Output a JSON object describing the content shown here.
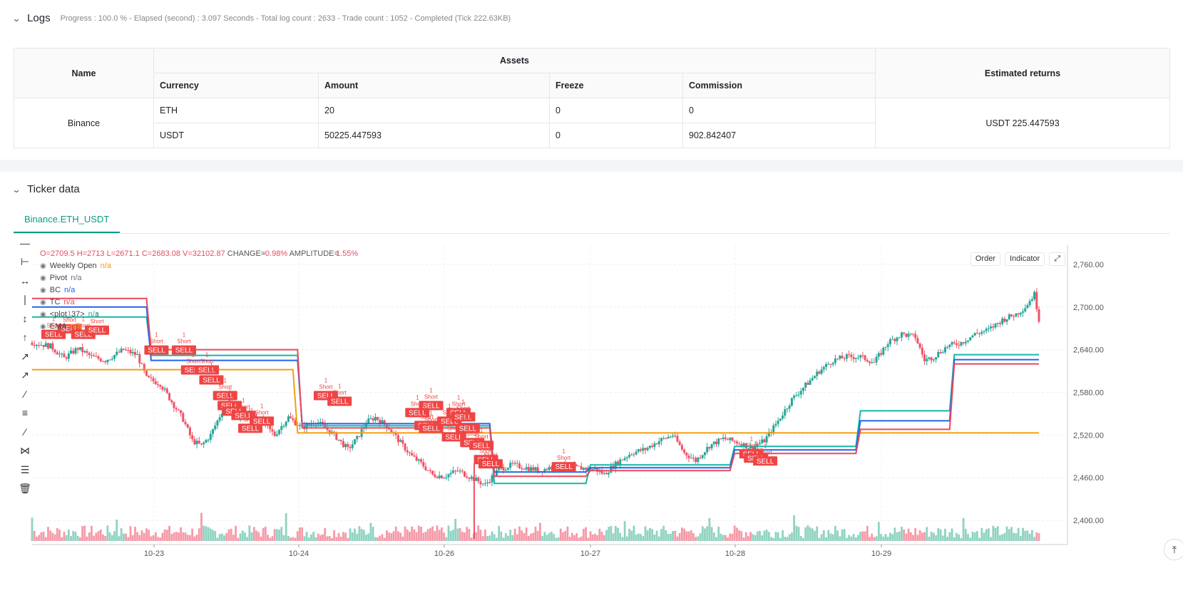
{
  "logs": {
    "title": "Logs",
    "summary": "Progress : 100.0 % - Elapsed (second) : 3.097  Seconds - Total log count : 2633 - Trade count : 1052 - Completed (Tick 222.63KB)",
    "table": {
      "name_header": "Name",
      "assets_header": "Assets",
      "returns_header": "Estimated returns",
      "sub_headers": [
        "Currency",
        "Amount",
        "Freeze",
        "Commission"
      ],
      "exchange": "Binance",
      "rows": [
        {
          "currency": "ETH",
          "amount": "20",
          "freeze": "0",
          "commission": "0"
        },
        {
          "currency": "USDT",
          "amount": "50225.447593",
          "freeze": "0",
          "commission": "902.842407"
        }
      ],
      "estimated_returns": "USDT 225.447593"
    }
  },
  "ticker": {
    "title": "Ticker data",
    "tab": "Binance.ETH_USDT",
    "buttons": {
      "order": "Order",
      "indicator": "Indicator"
    },
    "ohlc": {
      "o": "O=2709.5",
      "h": "H=2713",
      "l": "L=2671.1",
      "c": "C=2683.08",
      "v": "V=32102.87",
      "change_label": "CHANGE=",
      "change": "-0.98%",
      "amplitude_label": "AMPLITUDE=",
      "amplitude": "1.55%"
    },
    "legend": [
      {
        "name": "Weekly Open",
        "value": "n/a",
        "color": "#f59e0b"
      },
      {
        "name": "Pivot",
        "value": "n/a",
        "color": "#6b7280"
      },
      {
        "name": "BC",
        "value": "n/a",
        "color": "#2563eb"
      },
      {
        "name": "TC",
        "value": "n/a",
        "color": "#e84a5f"
      },
      {
        "name": "<plot_37>",
        "value": "n/a",
        "color": "#14b8a6"
      },
      {
        "name": "EMA",
        "value": "n/a",
        "color": "#f59e0b"
      }
    ],
    "signal_labels": {
      "sell": "SELL",
      "short": "Short",
      "qty": "1"
    }
  },
  "chart_data": {
    "type": "candlestick",
    "y_axis_ticks": [
      "2,760.00",
      "2,700.00",
      "2,640.00",
      "2,580.00",
      "2,520.00",
      "2,460.00",
      "2,400.00"
    ],
    "y_ticks_values": [
      2760,
      2700,
      2640,
      2580,
      2520,
      2460,
      2400
    ],
    "x_axis_ticks": [
      "10-23",
      "10-24",
      "10-26",
      "10-27",
      "10-28",
      "10-29"
    ],
    "colors": {
      "up": "#26a69a",
      "down": "#ef5366",
      "tc": "#e84a5f",
      "bc": "#2563eb",
      "pivot_top": "#14b8a6",
      "weekly_open": "#f59e0b",
      "sell_label": "#ef4444"
    },
    "close_path": [
      [
        0,
        2650
      ],
      [
        8,
        2645
      ],
      [
        14,
        2628
      ],
      [
        20,
        2642
      ],
      [
        26,
        2630
      ],
      [
        32,
        2625
      ],
      [
        40,
        2640
      ],
      [
        46,
        2632
      ],
      [
        50,
        2600
      ],
      [
        56,
        2592
      ],
      [
        60,
        2572
      ],
      [
        66,
        2542
      ],
      [
        70,
        2512
      ],
      [
        74,
        2505
      ],
      [
        78,
        2520
      ],
      [
        84,
        2560
      ],
      [
        90,
        2548
      ],
      [
        96,
        2553
      ],
      [
        100,
        2540
      ],
      [
        106,
        2520
      ],
      [
        112,
        2545
      ],
      [
        118,
        2530
      ],
      [
        124,
        2540
      ],
      [
        132,
        2520
      ],
      [
        138,
        2500
      ],
      [
        142,
        2515
      ],
      [
        146,
        2538
      ],
      [
        150,
        2545
      ],
      [
        156,
        2530
      ],
      [
        162,
        2505
      ],
      [
        166,
        2490
      ],
      [
        170,
        2480
      ],
      [
        175,
        2464
      ],
      [
        180,
        2462
      ],
      [
        186,
        2470
      ],
      [
        192,
        2460
      ],
      [
        198,
        2450
      ],
      [
        204,
        2472
      ],
      [
        210,
        2478
      ],
      [
        216,
        2474
      ],
      [
        222,
        2470
      ],
      [
        230,
        2478
      ],
      [
        238,
        2474
      ],
      [
        246,
        2472
      ],
      [
        250,
        2465
      ],
      [
        256,
        2482
      ],
      [
        262,
        2495
      ],
      [
        268,
        2500
      ],
      [
        274,
        2512
      ],
      [
        280,
        2520
      ],
      [
        285,
        2495
      ],
      [
        290,
        2484
      ],
      [
        296,
        2505
      ],
      [
        302,
        2515
      ],
      [
        308,
        2510
      ],
      [
        314,
        2502
      ],
      [
        320,
        2512
      ],
      [
        326,
        2540
      ],
      [
        332,
        2570
      ],
      [
        338,
        2590
      ],
      [
        344,
        2610
      ],
      [
        350,
        2625
      ],
      [
        356,
        2630
      ],
      [
        362,
        2630
      ],
      [
        368,
        2622
      ],
      [
        374,
        2650
      ],
      [
        380,
        2662
      ],
      [
        386,
        2658
      ],
      [
        390,
        2625
      ],
      [
        394,
        2630
      ],
      [
        400,
        2645
      ],
      [
        406,
        2650
      ],
      [
        412,
        2662
      ],
      [
        418,
        2668
      ],
      [
        424,
        2682
      ],
      [
        430,
        2690
      ],
      [
        434,
        2700
      ],
      [
        438,
        2718
      ],
      [
        440,
        2683
      ]
    ],
    "tc_steps": [
      [
        0,
        2712
      ],
      [
        50,
        2712
      ],
      [
        52,
        2640
      ],
      [
        116,
        2640
      ],
      [
        118,
        2530
      ],
      [
        200,
        2530
      ],
      [
        202,
        2462
      ],
      [
        242,
        2462
      ],
      [
        244,
        2470
      ],
      [
        305,
        2470
      ],
      [
        307,
        2494
      ],
      [
        360,
        2494
      ],
      [
        362,
        2528
      ],
      [
        401,
        2528
      ],
      [
        403,
        2620
      ],
      [
        440,
        2620
      ]
    ],
    "bc_steps": [
      [
        0,
        2700
      ],
      [
        50,
        2700
      ],
      [
        52,
        2625
      ],
      [
        116,
        2625
      ],
      [
        118,
        2536
      ],
      [
        200,
        2536
      ],
      [
        202,
        2468
      ],
      [
        242,
        2468
      ],
      [
        244,
        2474
      ],
      [
        305,
        2474
      ],
      [
        307,
        2499
      ],
      [
        360,
        2499
      ],
      [
        362,
        2540
      ],
      [
        401,
        2540
      ],
      [
        403,
        2626
      ],
      [
        440,
        2626
      ]
    ],
    "pivot_top_steps": [
      [
        0,
        2686
      ],
      [
        50,
        2686
      ],
      [
        52,
        2632
      ],
      [
        116,
        2632
      ],
      [
        118,
        2533
      ],
      [
        200,
        2533
      ],
      [
        202,
        2452
      ],
      [
        242,
        2452
      ],
      [
        244,
        2478
      ],
      [
        305,
        2478
      ],
      [
        307,
        2504
      ],
      [
        360,
        2504
      ],
      [
        362,
        2554
      ],
      [
        401,
        2554
      ],
      [
        403,
        2633
      ],
      [
        440,
        2633
      ]
    ],
    "weekly_open_steps": [
      [
        0,
        2612
      ],
      [
        114,
        2612
      ],
      [
        116,
        2523
      ],
      [
        440,
        2523
      ]
    ],
    "sell_signals": [
      [
        5,
        2654
      ],
      [
        12,
        2662
      ],
      [
        18,
        2654
      ],
      [
        24,
        2660
      ],
      [
        50,
        2632
      ],
      [
        62,
        2632
      ],
      [
        66,
        2604
      ],
      [
        72,
        2604
      ],
      [
        74,
        2590
      ],
      [
        80,
        2568
      ],
      [
        82,
        2554
      ],
      [
        84,
        2546
      ],
      [
        88,
        2540
      ],
      [
        91,
        2522
      ],
      [
        96,
        2532
      ],
      [
        124,
        2568
      ],
      [
        130,
        2560
      ],
      [
        170,
        2554
      ],
      [
        164,
        2544
      ],
      [
        168,
        2526
      ],
      [
        170,
        2522
      ],
      [
        178,
        2532
      ],
      [
        180,
        2510
      ],
      [
        182,
        2544
      ],
      [
        184,
        2538
      ],
      [
        186,
        2522
      ],
      [
        188,
        2502
      ],
      [
        192,
        2498
      ],
      [
        194,
        2478
      ],
      [
        196,
        2472
      ],
      [
        228,
        2468
      ],
      [
        310,
        2486
      ],
      [
        312,
        2480
      ],
      [
        316,
        2476
      ]
    ],
    "volume_seed": 7
  }
}
